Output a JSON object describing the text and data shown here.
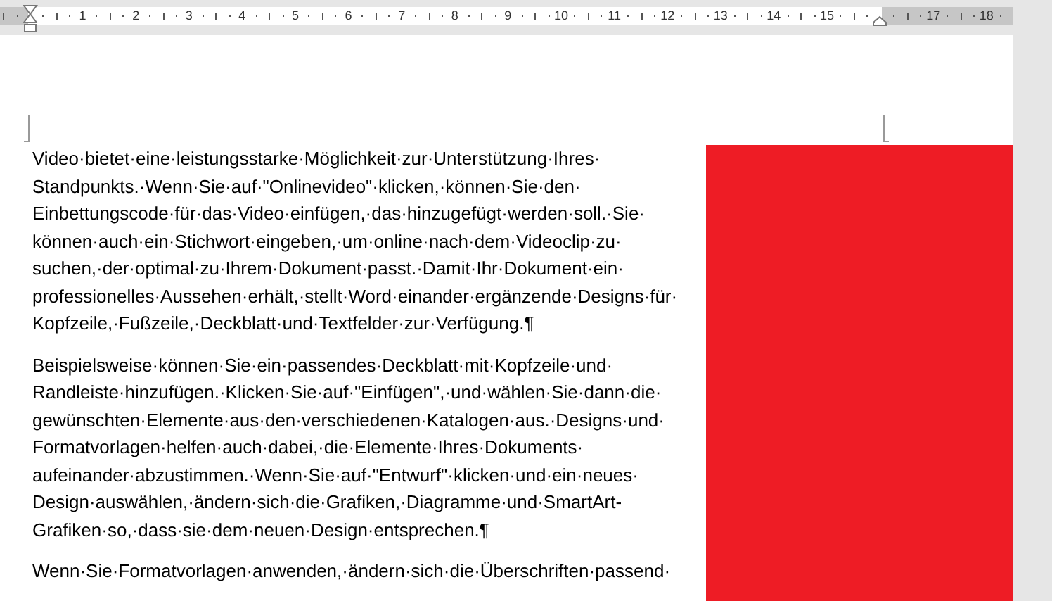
{
  "ruler": {
    "marks": [
      {
        "kind": "number",
        "label": "1"
      },
      {
        "kind": "number",
        "label": "2"
      },
      {
        "kind": "number",
        "label": "3"
      },
      {
        "kind": "number",
        "label": "4"
      },
      {
        "kind": "number",
        "label": "5"
      },
      {
        "kind": "number",
        "label": "6"
      },
      {
        "kind": "number",
        "label": "7"
      },
      {
        "kind": "number",
        "label": "8"
      },
      {
        "kind": "number",
        "label": "9"
      },
      {
        "kind": "number",
        "label": "10"
      },
      {
        "kind": "number",
        "label": "11"
      },
      {
        "kind": "number",
        "label": "12"
      },
      {
        "kind": "number",
        "label": "13"
      },
      {
        "kind": "number",
        "label": "14"
      },
      {
        "kind": "number",
        "label": "15"
      },
      {
        "kind": "right-indent"
      },
      {
        "kind": "number",
        "label": "17"
      },
      {
        "kind": "number",
        "label": "18"
      }
    ]
  },
  "paragraphs": [
    {
      "lines": [
        "Video·bietet·eine·leistungsstarke·Möglichkeit·zur·Unterstützung·Ihres·",
        "Standpunkts.·Wenn·Sie·auf·\"Onlinevideo\"·klicken,·können·Sie·den·",
        "Einbettungscode·für·das·Video·einfügen,·das·hinzugefügt·werden·soll.·Sie·",
        "können·auch·ein·Stichwort·eingeben,·um·online·nach·dem·Videoclip·zu·",
        "suchen,·der·optimal·zu·Ihrem·Dokument·passt.·Damit·Ihr·Dokument·ein·",
        "professionelles·Aussehen·erhält,·stellt·Word·einander·ergänzende·Designs·für·",
        "Kopfzeile,·Fußzeile,·Deckblatt·und·Textfelder·zur·Verfügung.¶"
      ]
    },
    {
      "lines": [
        "Beispielsweise·können·Sie·ein·passendes·Deckblatt·mit·Kopfzeile·und·",
        "Randleiste·hinzufügen.·Klicken·Sie·auf·\"Einfügen\",·und·wählen·Sie·dann·die·",
        "gewünschten·Elemente·aus·den·verschiedenen·Katalogen·aus.·Designs·und·",
        "Formatvorlagen·helfen·auch·dabei,·die·Elemente·Ihres·Dokuments·",
        "aufeinander·abzustimmen.·Wenn·Sie·auf·\"Entwurf\"·klicken·und·ein·neues·",
        "Design·auswählen,·ändern·sich·die·Grafiken,·Diagramme·und·SmartArt-",
        "Grafiken·so,·dass·sie·dem·neuen·Design·entsprechen.¶"
      ]
    },
    {
      "lines": [
        "Wenn·Sie·Formatvorlagen·anwenden,·ändern·sich·die·Überschriften·passend·"
      ]
    }
  ]
}
